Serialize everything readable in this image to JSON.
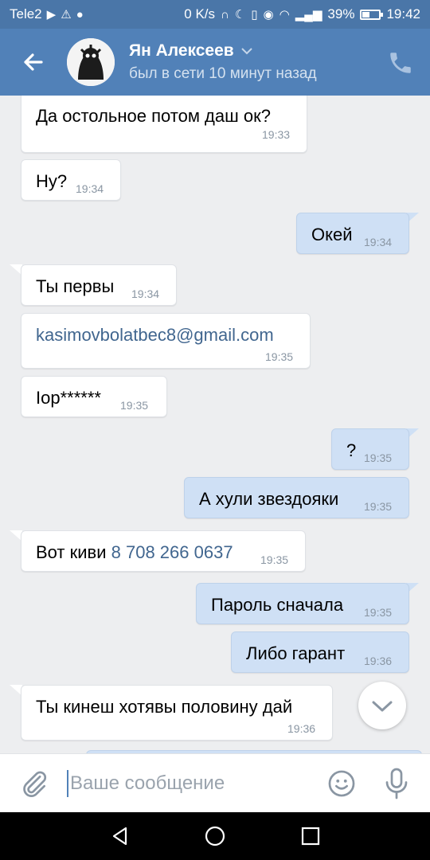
{
  "status_bar": {
    "carrier": "Tele2",
    "network_speed": "0 K/s",
    "battery": "39%",
    "time": "19:42"
  },
  "header": {
    "name": "Ян Алексеев",
    "status": "был в сети 10 минут назад"
  },
  "messages": [
    {
      "dir": "in",
      "text": "Да остольное потом даш ок?",
      "time": "19:33"
    },
    {
      "dir": "in",
      "text": "Ну?",
      "time": "19:34"
    },
    {
      "dir": "out",
      "text": "Окей",
      "time": "19:34"
    },
    {
      "dir": "in",
      "text": "Ты первы",
      "time": "19:34"
    },
    {
      "dir": "in",
      "text": "kasimovbolatbec8@gmail.com",
      "time": "19:35"
    },
    {
      "dir": "in",
      "text": "Iop******",
      "time": "19:35"
    },
    {
      "dir": "out",
      "text": "?",
      "time": "19:35"
    },
    {
      "dir": "out",
      "text": "А хули звездояки",
      "time": "19:35"
    },
    {
      "dir": "in",
      "text": "Вот киви",
      "link": "8 708 266 0637",
      "time": "19:35"
    },
    {
      "dir": "out",
      "text": "Пароль сначала",
      "time": "19:35"
    },
    {
      "dir": "out",
      "text": "Либо гарант",
      "time": "19:36"
    },
    {
      "dir": "in",
      "text": "Ты кинеш хотявы половину дай",
      "time": "19:36"
    }
  ],
  "composer": {
    "placeholder": "Ваше сообщение",
    "value": ""
  },
  "colors": {
    "header": "#5181b8",
    "status_bar": "#4a76a8",
    "incoming_bubble": "#ffffff",
    "outgoing_bubble": "#cfe0f5",
    "link": "#41668f",
    "chat_background": "#edeef0"
  }
}
